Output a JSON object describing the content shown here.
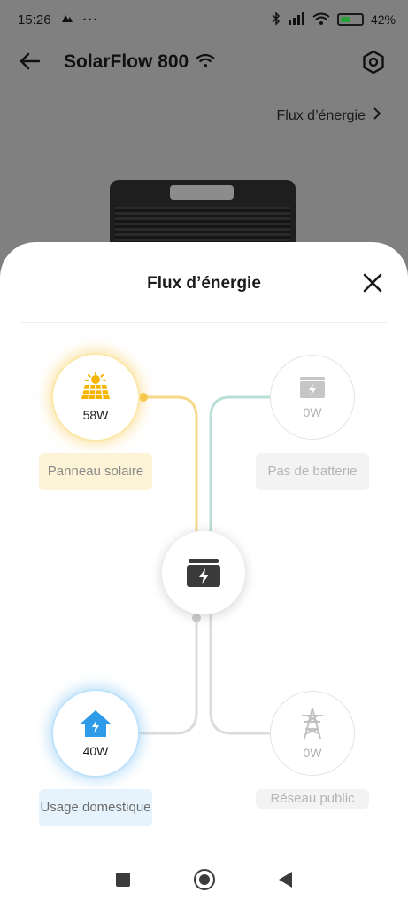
{
  "status_bar": {
    "time": "15:26",
    "dots": "···",
    "battery_percent": "42%"
  },
  "header": {
    "device_name": "SolarFlow 800",
    "energy_flow_link": "Flux d’énergie"
  },
  "sheet": {
    "title": "Flux d’énergie",
    "nodes": {
      "solar": {
        "value": "58W",
        "label": "Panneau solaire",
        "color": "#f5b400"
      },
      "battery": {
        "value": "0W",
        "label": "Pas de batterie"
      },
      "home": {
        "value": "40W",
        "label": "Usage domestique",
        "color": "#2e9be8"
      },
      "grid": {
        "value": "0W",
        "label": "Réseau public"
      }
    }
  },
  "colors": {
    "solar_line": "#f7d98a",
    "battery_line": "#b8e0d8",
    "home_line": "#dcdcdc"
  }
}
